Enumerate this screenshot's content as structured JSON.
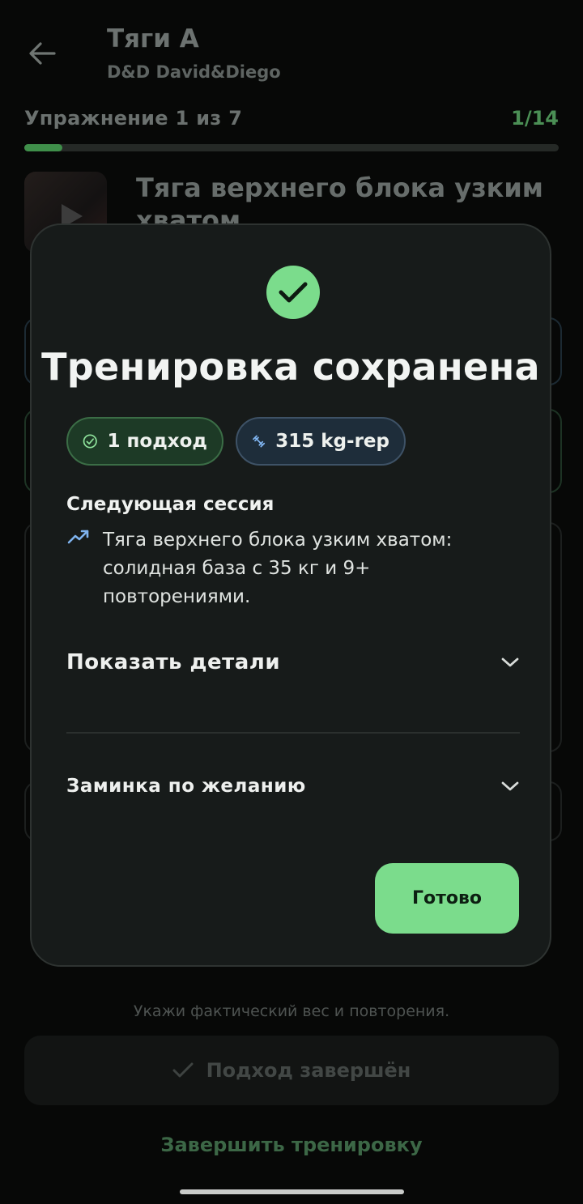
{
  "header": {
    "title": "Тяги А",
    "subtitle": "D&D David&Diego"
  },
  "progress": {
    "exercise_label": "Упражнение 1 из 7",
    "set_counter": "1/14",
    "fraction": 0.0714
  },
  "exercise": {
    "name": "Тяга верхнего блока узким хватом"
  },
  "footer": {
    "hint": "Укажи фактический вес и повторения.",
    "set_done_label": "Подход завершён",
    "finish_label": "Завершить тренировку"
  },
  "modal": {
    "title": "Тренировка сохранена",
    "chips": [
      {
        "label": "1 подход",
        "icon": "check-circle-icon"
      },
      {
        "label": "315 kg-rep",
        "icon": "dumbbell-icon"
      }
    ],
    "next_session": {
      "heading": "Следующая сессия",
      "text": "Тяга верхнего блока узким хватом: солидная база с 35 кг и 9+ повторениями.",
      "icon": "trending-up-icon"
    },
    "details_label": "Показать детали",
    "cooldown_label": "Заминка по желанию",
    "done_label": "Готово"
  },
  "colors": {
    "accent_green": "#7bdc8c",
    "chip_blue": "#1e2d3a",
    "modal_bg": "#171b1a"
  }
}
